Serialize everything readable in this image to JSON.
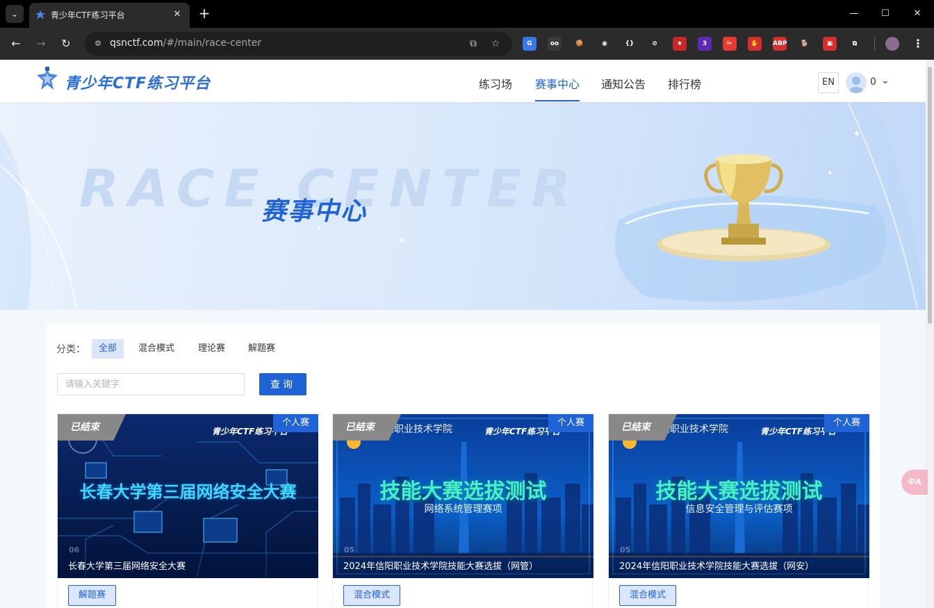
{
  "browser": {
    "tab_title": "青少年CTF练习平台",
    "url_host": "qsnctf.com",
    "url_path": "/#/main/race-center",
    "extensions": [
      {
        "name": "translate-ext",
        "color": "#3b78e7",
        "glyph": "G"
      },
      {
        "name": "glasses-ext",
        "color": "#3a3a3a",
        "glyph": "oo"
      },
      {
        "name": "cookie-ext",
        "color": "#2b2b2b",
        "glyph": "🍪"
      },
      {
        "name": "owl-ext",
        "color": "#2b2b2b",
        "glyph": "◉"
      },
      {
        "name": "json-ext",
        "color": "#2b2b2b",
        "glyph": "{}"
      },
      {
        "name": "compass-ext",
        "color": "#2b2b2b",
        "glyph": "⊘"
      },
      {
        "name": "flag-ext",
        "color": "#c62828",
        "glyph": "★"
      },
      {
        "name": "badge-ext",
        "color": "#5b2bb5",
        "glyph": "3"
      },
      {
        "name": "stop-ext",
        "color": "#e53935",
        "glyph": "⛔"
      },
      {
        "name": "hand-ext",
        "color": "#d32f2f",
        "glyph": "✋"
      },
      {
        "name": "abp-ext",
        "color": "#d32f2f",
        "glyph": "ABP"
      },
      {
        "name": "dog-ext",
        "color": "#2b2b2b",
        "glyph": "🐕"
      },
      {
        "name": "red-ext",
        "color": "#d32f2f",
        "glyph": "▣"
      },
      {
        "name": "puzzle-ext",
        "color": "#2b2b2b",
        "glyph": "⧉"
      }
    ]
  },
  "header": {
    "logo_text": "青少年CTF练习平台",
    "nav": [
      "练习场",
      "赛事中心",
      "通知公告",
      "排行榜"
    ],
    "active_nav": "赛事中心",
    "lang": "EN",
    "points": "0"
  },
  "banner": {
    "en_title": "RACE CENTER",
    "cn_title": "赛事中心"
  },
  "filters": {
    "label": "分类：",
    "items": [
      "全部",
      "混合模式",
      "理论赛",
      "解题赛"
    ],
    "active": "全部"
  },
  "search": {
    "placeholder": "请输入关键字",
    "button": "查询"
  },
  "cards": [
    {
      "status": "已结束",
      "type": "个人赛",
      "headline": "长春大学第三届网络安全大赛",
      "subheadline": "",
      "number": "06",
      "title": "长春大学第三届网络安全大赛",
      "tag": "解题赛"
    },
    {
      "status": "已结束",
      "type": "个人赛",
      "headline": "技能大赛选拔测试",
      "subheadline": "网络系统管理赛项",
      "number": "05",
      "title": "2024年信阳职业技术学院技能大赛选拔（网管）",
      "tag": "混合模式"
    },
    {
      "status": "已结束",
      "type": "个人赛",
      "headline": "技能大赛选拔测试",
      "subheadline": "信息安全管理与评估赛项",
      "number": "05",
      "title": "2024年信阳职业技术学院技能大赛选拔（网安）",
      "tag": "混合模式"
    }
  ],
  "card_brand": "青少年CTF练习平台",
  "floating": {
    "translate_label": "中A"
  }
}
